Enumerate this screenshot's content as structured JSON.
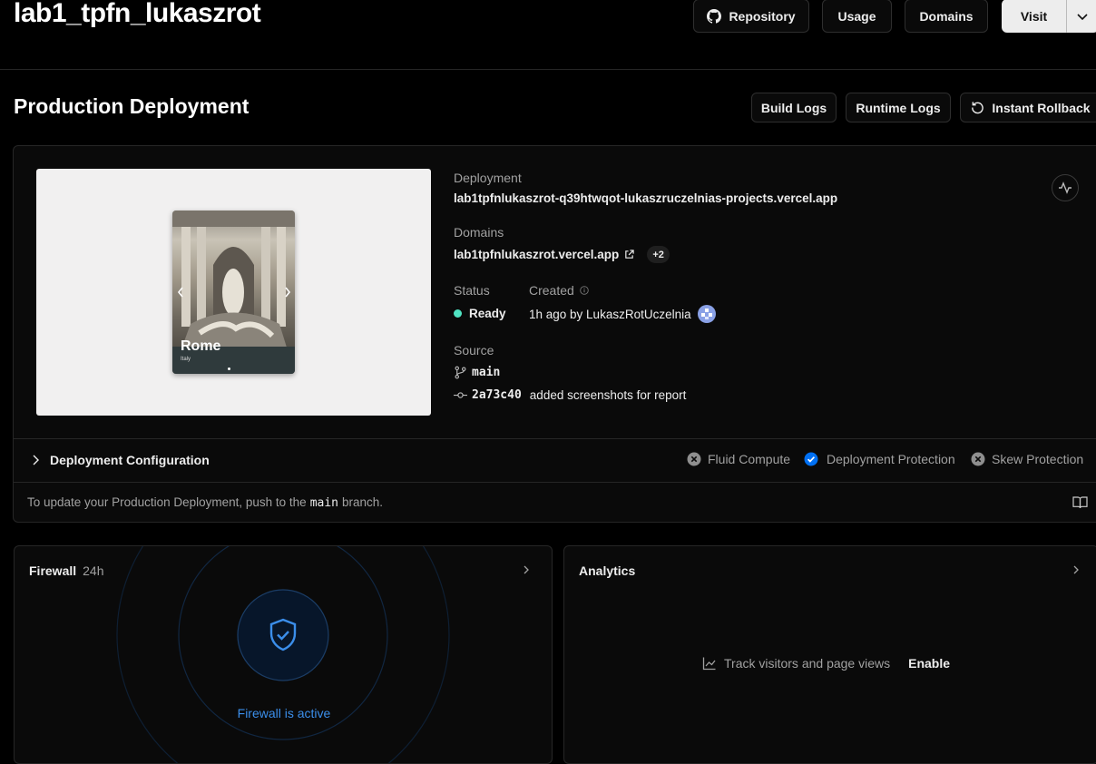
{
  "header": {
    "project_name": "lab1_tpfn_lukaszrot",
    "repository_label": "Repository",
    "usage_label": "Usage",
    "domains_label": "Domains",
    "visit_label": "Visit"
  },
  "production": {
    "title": "Production Deployment",
    "build_logs_label": "Build Logs",
    "runtime_logs_label": "Runtime Logs",
    "instant_rollback_label": "Instant Rollback"
  },
  "preview": {
    "city": "Rome",
    "country": "Italy"
  },
  "deployment": {
    "label": "Deployment",
    "url": "lab1tpfnlukaszrot-q39htwqot-lukaszruczelnias-projects.vercel.app"
  },
  "domains": {
    "label": "Domains",
    "primary": "lab1tpfnlukaszrot.vercel.app",
    "extra_count": "+2"
  },
  "status": {
    "label": "Status",
    "value": "Ready",
    "color": "#50e3c2"
  },
  "created": {
    "label": "Created",
    "value": "1h ago by LukaszRotUczelnia"
  },
  "source": {
    "label": "Source",
    "branch": "main",
    "commit_hash": "2a73c40",
    "commit_message": "added screenshots for report"
  },
  "config": {
    "label": "Deployment Configuration",
    "features": [
      {
        "name": "Fluid Compute",
        "enabled": false
      },
      {
        "name": "Deployment Protection",
        "enabled": true
      },
      {
        "name": "Skew Protection",
        "enabled": false
      }
    ]
  },
  "footer_note": {
    "before": "To update your Production Deployment, push to the",
    "branch": "main",
    "after": "branch."
  },
  "firewall": {
    "title": "Firewall",
    "period": "24h",
    "status_text": "Firewall is active",
    "accent": "#3b8eea"
  },
  "analytics": {
    "title": "Analytics",
    "prompt": "Track visitors and page views",
    "enable_label": "Enable"
  }
}
